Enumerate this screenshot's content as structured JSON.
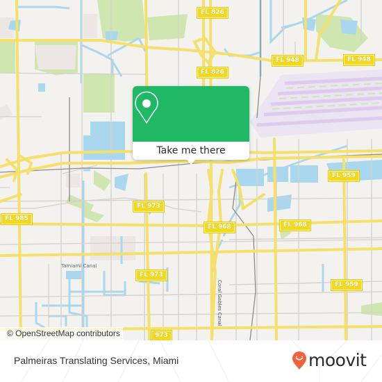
{
  "map": {
    "attribution": "© OpenStreetMap contributors",
    "road_shields": [
      {
        "label": "FL 826"
      },
      {
        "label": "FL 826"
      },
      {
        "label": "FL 948"
      },
      {
        "label": "FL 948"
      },
      {
        "label": "FL 959"
      },
      {
        "label": "FL 973"
      },
      {
        "label": "FL 985"
      },
      {
        "label": "FL 968"
      },
      {
        "label": "FL 968"
      },
      {
        "label": "FL 973"
      },
      {
        "label": "FL 959"
      },
      {
        "label": "973"
      }
    ],
    "feature_labels": {
      "canal": "Tamiami Canal",
      "road": "Coral Gables Canal"
    },
    "colors": {
      "land": "#f3f2ef",
      "water": "#a9d8ee",
      "park": "#cfe6b1",
      "road_major": "#f7e06a",
      "road_minor": "#d4d0cb",
      "airport": "#e6dcf2",
      "popup_green": "#20b864"
    }
  },
  "popup": {
    "icon": "map-pin-icon",
    "button_label": "Take me there"
  },
  "footer": {
    "place_name": "Palmeiras Translating Services, Miami",
    "brand": {
      "icon": "moovit-smile-pin-icon",
      "name": "moovit",
      "color": "#f0623a"
    }
  }
}
